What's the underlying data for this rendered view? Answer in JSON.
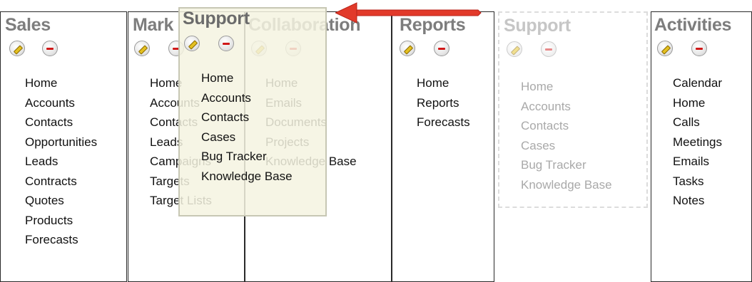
{
  "columns": [
    {
      "title": "Sales",
      "items": [
        "Home",
        "Accounts",
        "Contacts",
        "Opportunities",
        "Leads",
        "Contracts",
        "Quotes",
        "Products",
        "Forecasts"
      ]
    },
    {
      "title": "Mark",
      "items": [
        "Home",
        "Accounts",
        "Contacts",
        "Leads",
        "Campaigns",
        "Targets",
        "Target Lists"
      ]
    },
    {
      "title": "Collaboration",
      "items": [
        "Home",
        "Emails",
        "Documents",
        "Projects",
        "Knowledge Base"
      ]
    },
    {
      "title": "Reports",
      "items": [
        "Home",
        "Reports",
        "Forecasts"
      ]
    },
    {
      "title": "Support",
      "items": [
        "Home",
        "Accounts",
        "Contacts",
        "Cases",
        "Bug Tracker",
        "Knowledge Base"
      ]
    },
    {
      "title": "Activities",
      "items": [
        "Calendar",
        "Home",
        "Calls",
        "Meetings",
        "Emails",
        "Tasks",
        "Notes"
      ]
    }
  ],
  "dragging": {
    "title": "Support",
    "items": [
      "Home",
      "Accounts",
      "Contacts",
      "Cases",
      "Bug Tracker",
      "Knowledge Base"
    ]
  },
  "colors": {
    "title_gray": "#7d7d7d",
    "accent_red": "#e23a2a",
    "pencil_yellow": "#e4c020",
    "minus_red": "#d01818"
  },
  "icons": {
    "edit": "pencil-icon",
    "remove": "minus-icon",
    "arrow": "left-arrow-icon"
  }
}
